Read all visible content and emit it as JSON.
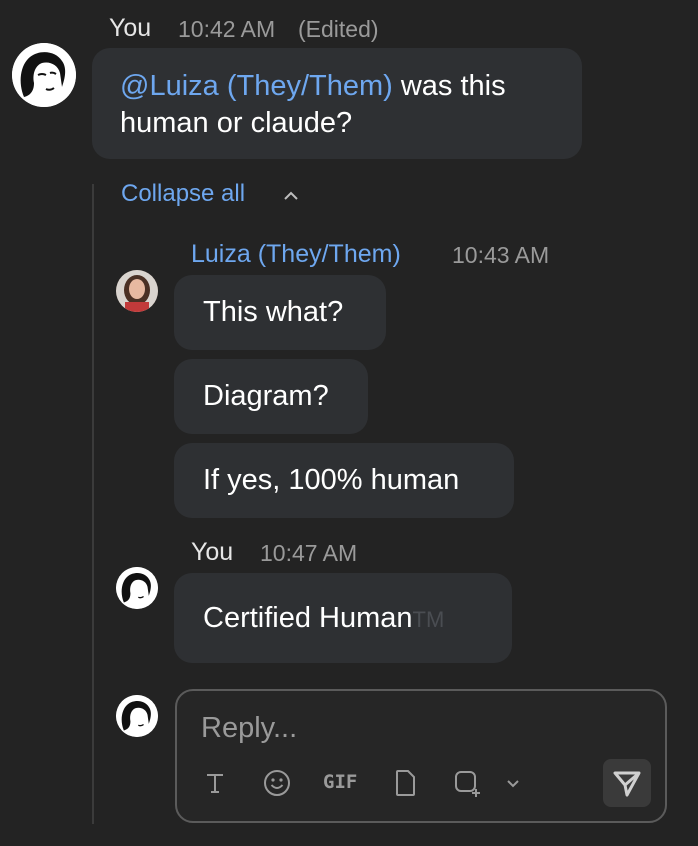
{
  "messages": [
    {
      "author": "You",
      "time": "10:42 AM",
      "edited": "(Edited)",
      "mention": "@Luiza (They/Them)",
      "text": " was this human or claude?"
    }
  ],
  "thread": {
    "collapse_label": "Collapse all",
    "reply1": {
      "author": "Luiza (They/Them)",
      "time": "10:43 AM",
      "bubbles": [
        "This what?",
        "Diagram?",
        "If yes, 100% human"
      ]
    },
    "reply2": {
      "author": "You",
      "time": "10:47 AM",
      "text": "Certified Human",
      "tm": "TM"
    }
  },
  "composer": {
    "placeholder": "Reply...",
    "tools": [
      "text-format-icon",
      "emoji-icon",
      "gif-icon",
      "file-icon",
      "add-media-icon",
      "chevron-down-icon",
      "send-icon"
    ],
    "gif_label": "GIF"
  },
  "colors": {
    "background": "#232323",
    "bubble": "#2e3033",
    "link": "#6ea7ef",
    "muted": "#9a9a9a"
  }
}
